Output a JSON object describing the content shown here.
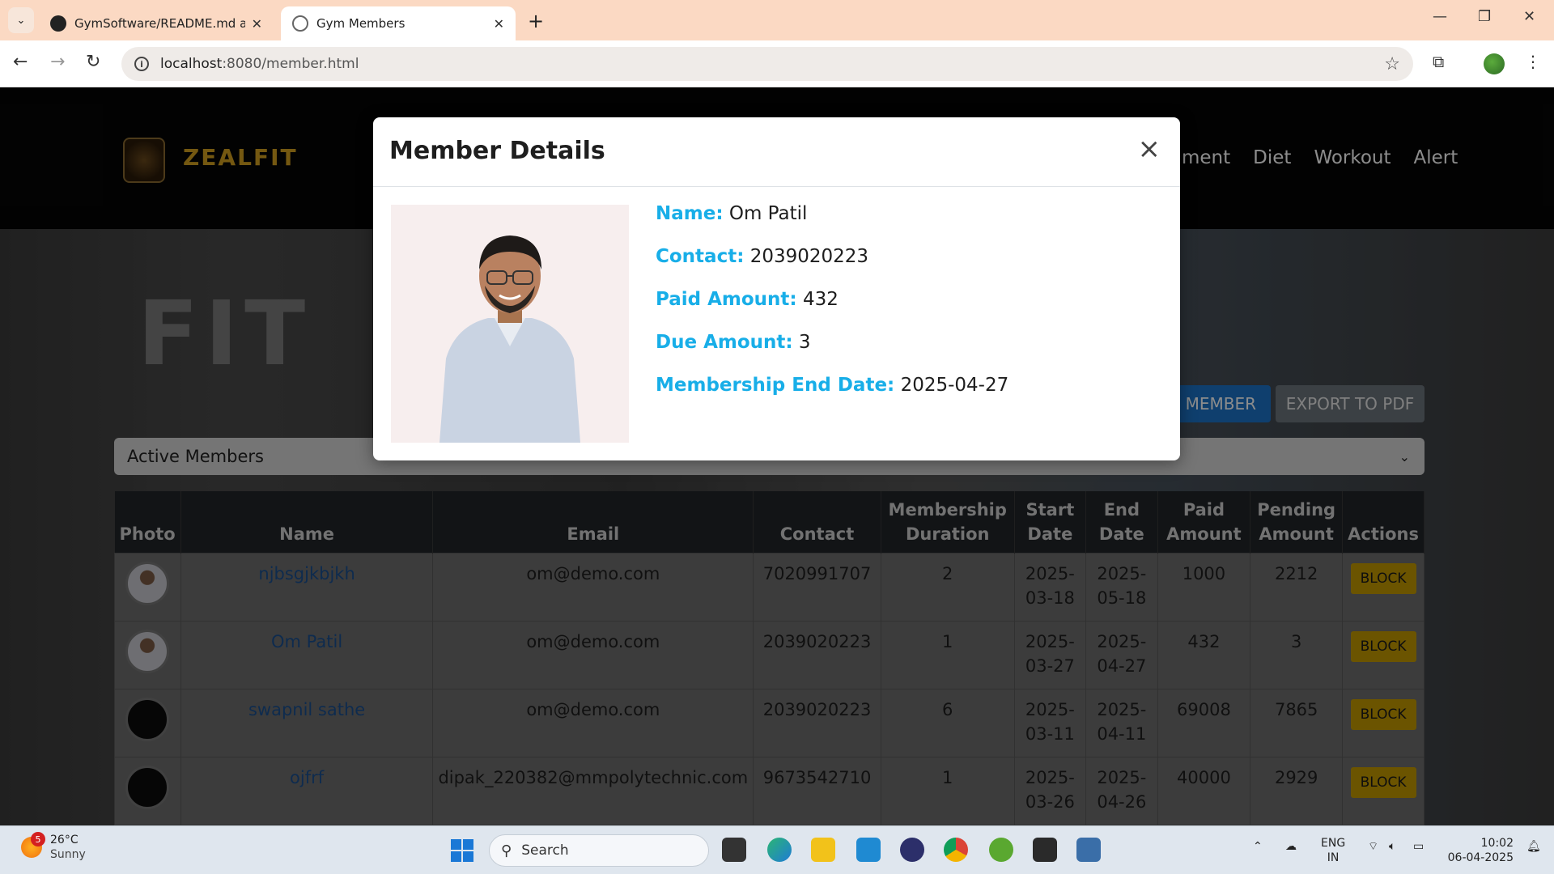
{
  "browser": {
    "tabs": [
      {
        "title": "GymSoftware/README.md at m",
        "active": false
      },
      {
        "title": "Gym Members",
        "active": true
      }
    ],
    "url_host": "localhost",
    "url_rest": ":8080/member.html"
  },
  "site": {
    "brand": "ZEALFIT",
    "nav": [
      "ment",
      "Diet",
      "Workout",
      "Alert"
    ],
    "hero_text": "FIT"
  },
  "controls": {
    "add_button": "MEMBER",
    "export_button": "EXPORT TO PDF",
    "filter_value": "Active Members"
  },
  "table": {
    "headers": [
      "Photo",
      "Name",
      "Email",
      "Contact",
      "Membership Duration",
      "Start Date",
      "End Date",
      "Paid Amount",
      "Pending Amount",
      "Actions"
    ],
    "rows": [
      {
        "name": "njbsgjkbjkh",
        "email": "om@demo.com",
        "contact": "7020991707",
        "duration": "2",
        "start": "2025-03-18",
        "end": "2025-05-18",
        "paid": "1000",
        "pending": "2212",
        "action": "BLOCK",
        "photo": "light"
      },
      {
        "name": "Om Patil",
        "email": "om@demo.com",
        "contact": "2039020223",
        "duration": "1",
        "start": "2025-03-27",
        "end": "2025-04-27",
        "paid": "432",
        "pending": "3",
        "action": "BLOCK",
        "photo": "light"
      },
      {
        "name": "swapnil sathe",
        "email": "om@demo.com",
        "contact": "2039020223",
        "duration": "6",
        "start": "2025-03-11",
        "end": "2025-04-11",
        "paid": "69008",
        "pending": "7865",
        "action": "BLOCK",
        "photo": "dark"
      },
      {
        "name": "ojfrf",
        "email": "dipak_220382@mmpolytechnic.com",
        "contact": "9673542710",
        "duration": "1",
        "start": "2025-03-26",
        "end": "2025-04-26",
        "paid": "40000",
        "pending": "2929",
        "action": "BLOCK",
        "photo": "dark"
      }
    ]
  },
  "modal": {
    "title": "Member Details",
    "close": "×",
    "fields": [
      {
        "label": "Name:",
        "value": "Om Patil"
      },
      {
        "label": "Contact:",
        "value": "2039020223"
      },
      {
        "label": "Paid Amount:",
        "value": "432"
      },
      {
        "label": "Due Amount:",
        "value": "3"
      },
      {
        "label": "Membership End Date:",
        "value": "2025-04-27"
      }
    ]
  },
  "taskbar": {
    "weather_temp": "26°C",
    "weather_desc": "Sunny",
    "weather_badge": "5",
    "search_placeholder": "Search",
    "lang_top": "ENG",
    "lang_bottom": "IN",
    "time": "10:02",
    "date": "06-04-2025"
  },
  "colors": {
    "label_accent": "#18aee8",
    "block_button": "#c49a00",
    "brand_gold": "#d4a020",
    "add_button": "#1d74c8"
  }
}
